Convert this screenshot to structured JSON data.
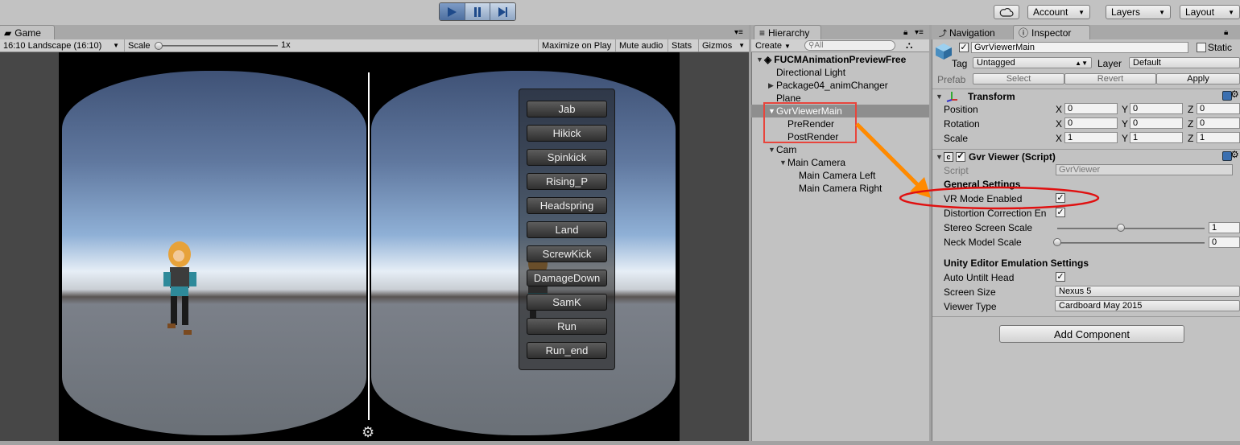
{
  "toolbar": {
    "account_label": "Account",
    "layers_label": "Layers",
    "layout_label": "Layout"
  },
  "game": {
    "tab_label": "Game",
    "aspect": "16:10 Landscape (16:10)",
    "scale_label": "Scale",
    "scale_value": "1x",
    "options": [
      "Maximize on Play",
      "Mute audio",
      "Stats",
      "Gizmos"
    ],
    "buttons": [
      "Jab",
      "Hikick",
      "Spinkick",
      "Rising_P",
      "Headspring",
      "Land",
      "ScrewKick",
      "DamageDown",
      "SamK",
      "Run",
      "Run_end"
    ]
  },
  "hierarchy": {
    "tab_label": "Hierarchy",
    "create_label": "Create",
    "search_placeholder": "All",
    "scene_name": "FUCMAnimationPreviewFree",
    "items": [
      {
        "label": "Directional Light",
        "level": 1,
        "arrow": ""
      },
      {
        "label": "Package04_animChanger",
        "level": 1,
        "arrow": "right"
      },
      {
        "label": "Plane",
        "level": 1,
        "arrow": ""
      },
      {
        "label": "GvrViewerMain",
        "level": 1,
        "arrow": "down",
        "selected": true
      },
      {
        "label": "PreRender",
        "level": 2,
        "arrow": ""
      },
      {
        "label": "PostRender",
        "level": 2,
        "arrow": ""
      },
      {
        "label": "Cam",
        "level": 1,
        "arrow": "down"
      },
      {
        "label": "Main Camera",
        "level": 2,
        "arrow": "down"
      },
      {
        "label": "Main Camera Left",
        "level": 3,
        "arrow": ""
      },
      {
        "label": "Main Camera Right",
        "level": 3,
        "arrow": ""
      }
    ]
  },
  "inspector": {
    "nav_tab": "Navigation",
    "tab_label": "Inspector",
    "object_name": "GvrViewerMain",
    "static_label": "Static",
    "tag_label": "Tag",
    "tag_value": "Untagged",
    "layer_label": "Layer",
    "layer_value": "Default",
    "prefab_label": "Prefab",
    "prefab_select": "Select",
    "prefab_revert": "Revert",
    "prefab_apply": "Apply",
    "transform": {
      "title": "Transform",
      "rows": [
        {
          "label": "Position",
          "x": "0",
          "y": "0",
          "z": "0"
        },
        {
          "label": "Rotation",
          "x": "0",
          "y": "0",
          "z": "0"
        },
        {
          "label": "Scale",
          "x": "1",
          "y": "1",
          "z": "1"
        }
      ]
    },
    "script": {
      "title": "Gvr Viewer (Script)",
      "script_label": "Script",
      "script_value": "GvrViewer",
      "general_header": "General Settings",
      "vr_mode_label": "VR Mode Enabled",
      "distortion_label": "Distortion Correction En",
      "stereo_label": "Stereo Screen Scale",
      "stereo_value": "1",
      "stereo_level": 0.43,
      "neck_label": "Neck Model Scale",
      "neck_value": "0",
      "neck_level": 0,
      "emulation_header": "Unity Editor Emulation Settings",
      "auto_untilt_label": "Auto Untilt Head",
      "screen_size_label": "Screen Size",
      "screen_size_value": "Nexus 5",
      "viewer_type_label": "Viewer Type",
      "viewer_type_value": "Cardboard May 2015"
    },
    "add_component": "Add Component"
  },
  "colors": {
    "highlight_box": "#e8453c",
    "arrow": "#ff8a00",
    "ellipse": "#e01010",
    "selection": "#8e8e8e"
  }
}
